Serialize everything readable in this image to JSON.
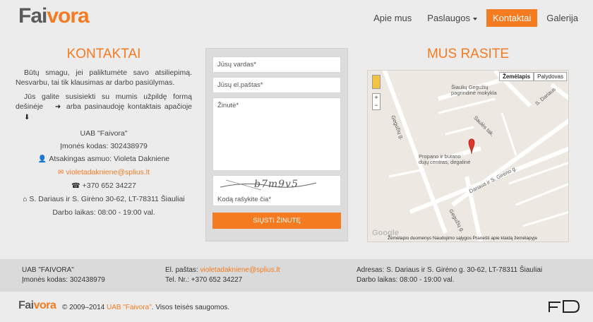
{
  "header": {
    "logo_part1": "Fai",
    "logo_part2": "vora",
    "nav": [
      {
        "label": "Apie mus"
      },
      {
        "label": "Paslaugos"
      },
      {
        "label": "Kontaktai"
      },
      {
        "label": "Galerija"
      }
    ]
  },
  "contacts": {
    "title": "KONTAKTAI",
    "para1": "Būtų smagu, jei palikt­umėte savo atsiliepimą. Nesvarbu, tai tik klausimas ar darbo pasiūlymas.",
    "para2a": "Jūs galite susisiekti su mumis užpildę formą dešinėje",
    "para2b": "arba pasinaudoję kontaktais apačioje",
    "company": "UAB \"Faivora\"",
    "company_code": "Įmonės kodas: 302438979",
    "responsible": "Atsakingas asmuo: Violeta Dakniene",
    "email": "violetadakniene@splius.lt",
    "phone": "+370 652 34227",
    "address": "S. Dariaus ir S. Girėno 30-62, LT-78311 Šiauliai",
    "hours": "Darbo laikas: 08:00 - 19:00 val."
  },
  "form": {
    "name_placeholder": "Jūsų vardas*",
    "email_placeholder": "Jūsų el.paštas*",
    "message_placeholder": "Žinutė*",
    "captcha_text": "b7m9v5",
    "captcha_placeholder": "Kodą rašykite čia*",
    "submit_label": "SIŲSTI ŽINUTĘ"
  },
  "map": {
    "title": "MUS RASITE",
    "btn_map": "Žemėlapis",
    "btn_satellite": "Palydovas",
    "zoom_in": "+",
    "zoom_out": "−",
    "labels": {
      "school": "Šiaulių Gegužių pagrindinė mokykla",
      "gas": "Propano ir butano dujų centras, degalinė",
      "street1": "Dariaus ir S. Girėno g.",
      "street2": "Gegužių g.",
      "street3": "Saulės tak.",
      "street4": "S. Dariaus",
      "street5": "Gegužių g."
    },
    "google": "Google",
    "footer_text": "Žemėlapio duomenys   Naudojimo sąlygos   Pranešti apie klaidą žemėlapyje"
  },
  "footer": {
    "col1_line1": "UAB \"FAIVORA\"",
    "col1_line2": "Įmonės kodas: 302438979",
    "col2_email_label": "El. paštas:",
    "col2_email": "violetadakniene@splius.lt",
    "col2_phone": "Tel. Nr.: +370 652 34227",
    "col3_address": "Adresas: S. Dariaus ir S. Girėno g. 30-62, LT-78311 Šiauliai",
    "col3_hours": "Darbo laikas: 08:00 - 19:00 val."
  },
  "bottom": {
    "logo_part1": "Fai",
    "logo_part2": "vora",
    "copyright_prefix": "© 2009–2014",
    "copyright_link": "UAB \"Faivora\"",
    "copyright_suffix": ". Visos teisės saugomos."
  },
  "colors": {
    "accent": "#f47b20",
    "background": "#ececec",
    "footer": "#dadada"
  }
}
